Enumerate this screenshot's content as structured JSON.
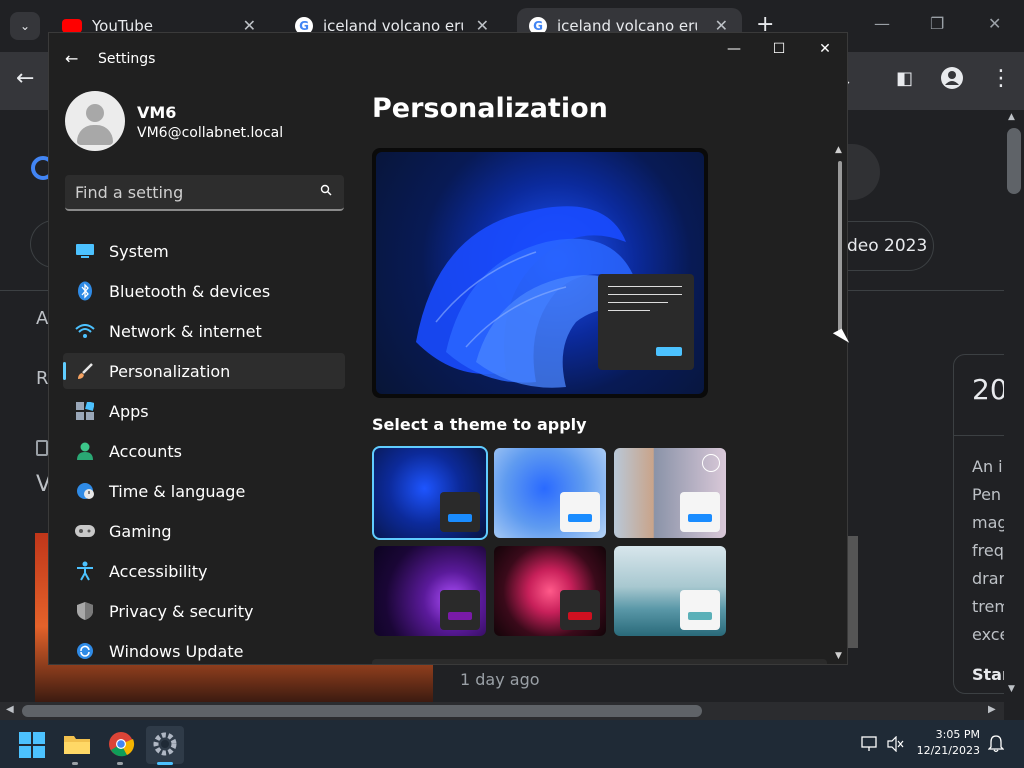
{
  "browser": {
    "tabs": [
      {
        "title": "YouTube",
        "icon": "youtube-icon"
      },
      {
        "title": "iceland volcano erupt",
        "icon": "google-icon"
      },
      {
        "title": "iceland volcano erupt",
        "icon": "google-icon",
        "active": true
      }
    ],
    "bg_texts": {
      "chip": "deo 2023",
      "card_heading": "20",
      "card_lines": [
        "An i",
        "Pen",
        "mag",
        "freq",
        "drar",
        "trem",
        "exce"
      ],
      "card_bold": "Star",
      "timestamp": "1 day ago",
      "left_letters": [
        "A",
        "R",
        "V"
      ]
    }
  },
  "settings": {
    "window_title": "Settings",
    "profile": {
      "name": "VM6",
      "email": "VM6@collabnet.local"
    },
    "search": {
      "placeholder": "Find a setting"
    },
    "nav": [
      {
        "label": "System",
        "icon": "system-icon",
        "color": "#4cc2ff"
      },
      {
        "label": "Bluetooth & devices",
        "icon": "bluetooth-icon",
        "color": "#4cc2ff"
      },
      {
        "label": "Network & internet",
        "icon": "wifi-icon",
        "color": "#4cc2ff"
      },
      {
        "label": "Personalization",
        "icon": "brush-icon",
        "color": "#f4a261",
        "selected": true
      },
      {
        "label": "Apps",
        "icon": "apps-icon",
        "color": "#9aa7b8"
      },
      {
        "label": "Accounts",
        "icon": "accounts-icon",
        "color": "#3cc68a"
      },
      {
        "label": "Time & language",
        "icon": "time-language-icon",
        "color": "#4cc2ff"
      },
      {
        "label": "Gaming",
        "icon": "gaming-icon",
        "color": "#c0c0c0"
      },
      {
        "label": "Accessibility",
        "icon": "accessibility-icon",
        "color": "#4cc2ff"
      },
      {
        "label": "Privacy & security",
        "icon": "shield-icon",
        "color": "#a0a0a0"
      },
      {
        "label": "Windows Update",
        "icon": "update-icon",
        "color": "#4cc2ff"
      }
    ],
    "content": {
      "title": "Personalization",
      "themes_label": "Select a theme to apply"
    },
    "accent_color": "#60cdff"
  },
  "taskbar": {
    "time": "3:05 PM",
    "date": "12/21/2023"
  }
}
